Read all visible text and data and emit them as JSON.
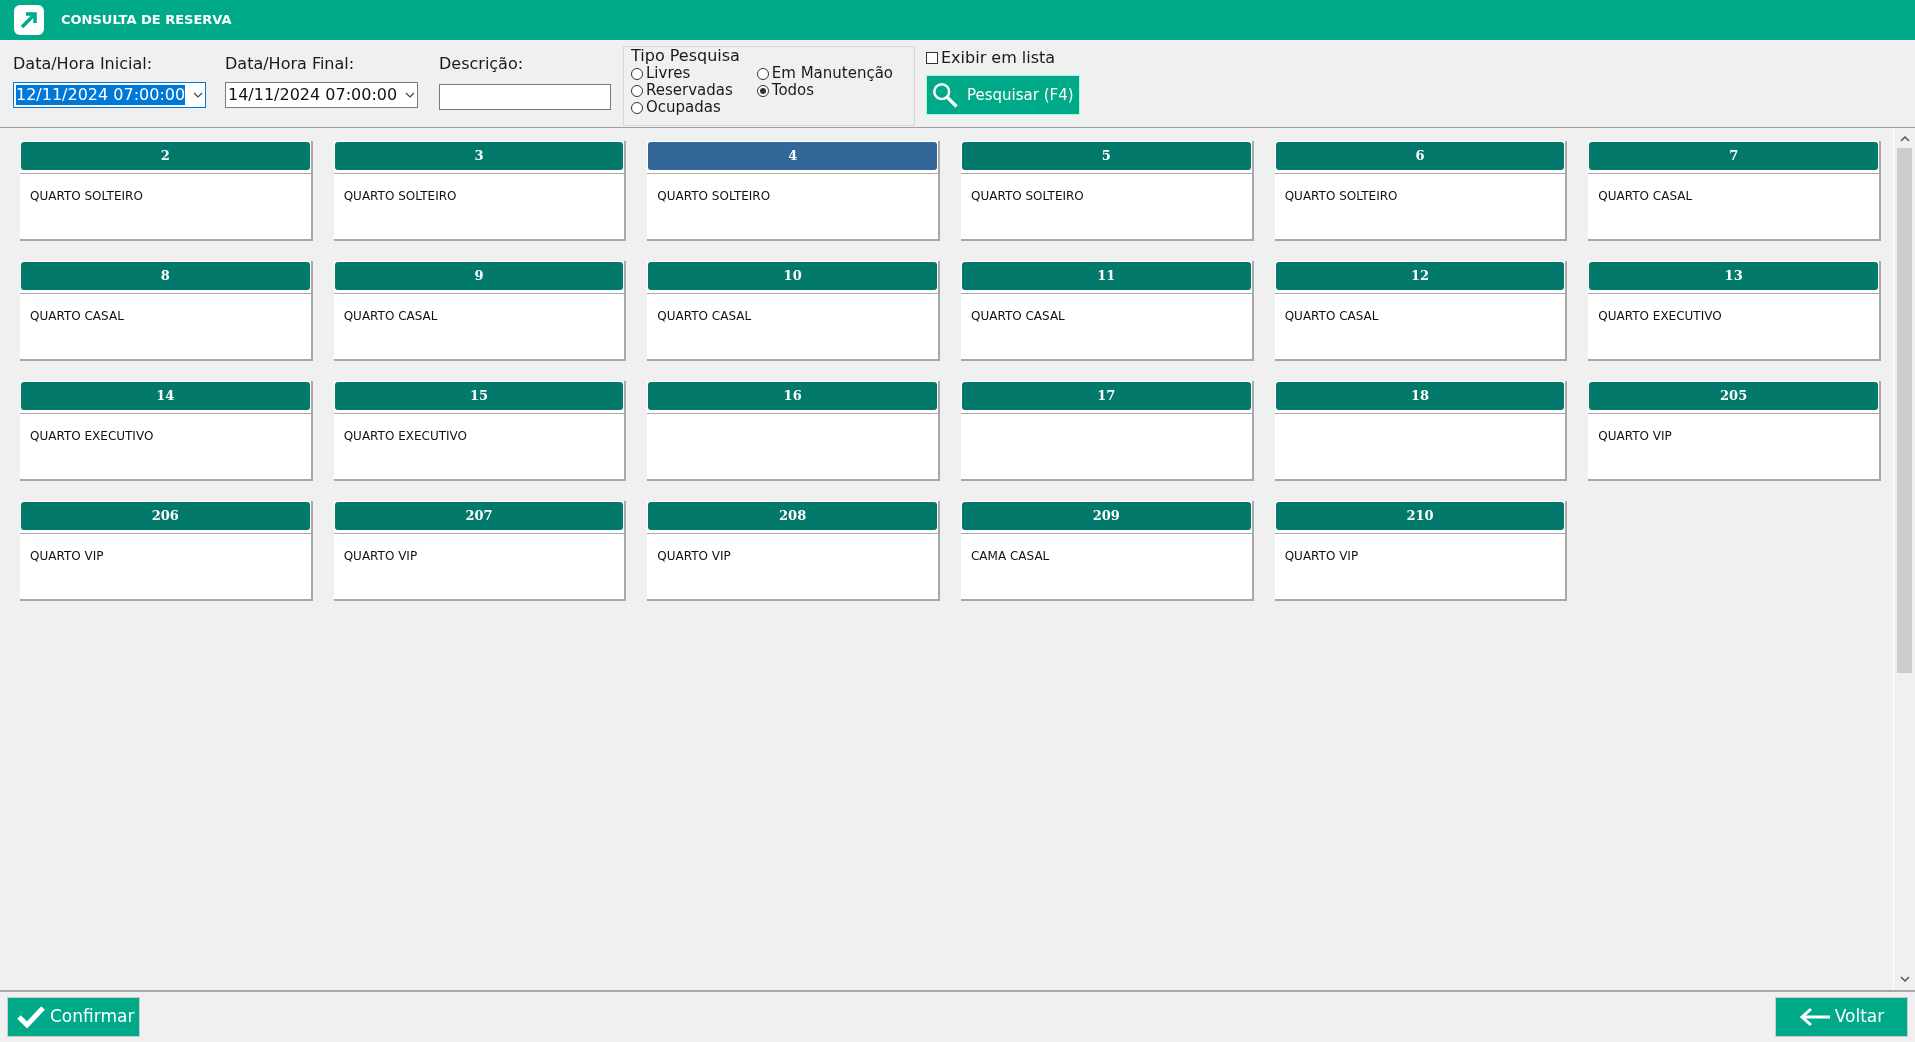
{
  "window": {
    "title": "CONSULTA DE RESERVA"
  },
  "filters": {
    "start": {
      "label": "Data/Hora Inicial:",
      "value": "12/11/2024 07:00:00",
      "focused": true
    },
    "end": {
      "label": "Data/Hora Final:",
      "value": "14/11/2024 07:00:00",
      "focused": false
    },
    "description": {
      "label": "Descrição:"
    },
    "search_type": {
      "title": "Tipo Pesquisa",
      "options": [
        {
          "label": "Livres",
          "selected": false
        },
        {
          "label": "Reservadas",
          "selected": false
        },
        {
          "label": "Ocupadas",
          "selected": false
        },
        {
          "label": "Em Manutenção",
          "selected": false
        },
        {
          "label": "Todos",
          "selected": true
        }
      ]
    },
    "list_view": {
      "label": "Exibir em lista",
      "checked": false
    },
    "search_button": "Pesquisar (F4)"
  },
  "rooms": [
    {
      "number": "2",
      "description": "QUARTO SOLTEIRO",
      "selected": false
    },
    {
      "number": "3",
      "description": "QUARTO SOLTEIRO",
      "selected": false
    },
    {
      "number": "4",
      "description": "QUARTO SOLTEIRO",
      "selected": true
    },
    {
      "number": "5",
      "description": "QUARTO SOLTEIRO",
      "selected": false
    },
    {
      "number": "6",
      "description": "QUARTO SOLTEIRO",
      "selected": false
    },
    {
      "number": "7",
      "description": "QUARTO CASAL",
      "selected": false
    },
    {
      "number": "8",
      "description": "QUARTO CASAL",
      "selected": false
    },
    {
      "number": "9",
      "description": "QUARTO CASAL",
      "selected": false
    },
    {
      "number": "10",
      "description": "QUARTO CASAL",
      "selected": false
    },
    {
      "number": "11",
      "description": "QUARTO CASAL",
      "selected": false
    },
    {
      "number": "12",
      "description": "QUARTO CASAL",
      "selected": false
    },
    {
      "number": "13",
      "description": "QUARTO EXECUTIVO",
      "selected": false
    },
    {
      "number": "14",
      "description": "QUARTO EXECUTIVO",
      "selected": false
    },
    {
      "number": "15",
      "description": "QUARTO EXECUTIVO",
      "selected": false
    },
    {
      "number": "16",
      "selected": false
    },
    {
      "number": "17",
      "selected": false
    },
    {
      "number": "18",
      "selected": false
    },
    {
      "number": "205",
      "description": "QUARTO VIP",
      "selected": false
    },
    {
      "number": "206",
      "description": "QUARTO VIP",
      "selected": false
    },
    {
      "number": "207",
      "description": "QUARTO VIP",
      "selected": false
    },
    {
      "number": "208",
      "description": "QUARTO VIP",
      "selected": false
    },
    {
      "number": "209",
      "description": "CAMA CASAL",
      "selected": false
    },
    {
      "number": "210",
      "description": "QUARTO VIP",
      "selected": false
    }
  ],
  "footer": {
    "confirm": "Confirmar",
    "back": "Voltar"
  }
}
